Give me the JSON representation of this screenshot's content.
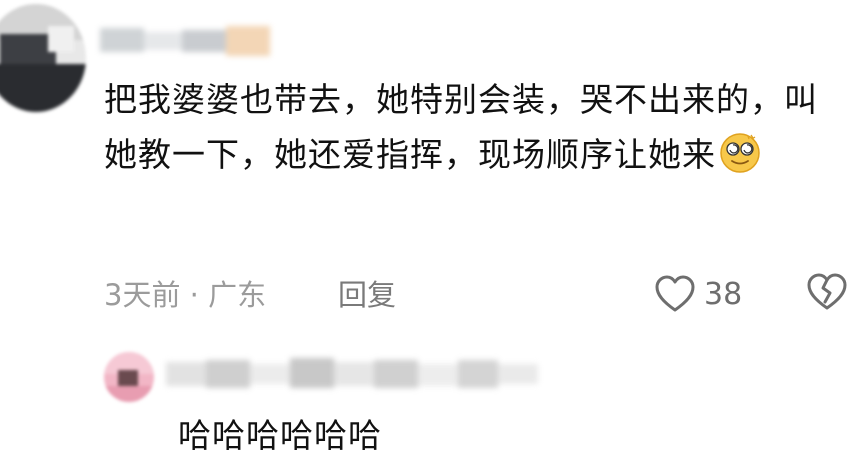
{
  "comment": {
    "text": "把我婆婆也带去，她特别会装，哭不出来的，叫她教一下，她还爱指挥，现场顺序让她来",
    "emoji_icon": "dizzy-face-emoji-icon",
    "time_location": "3天前 · 广东",
    "reply_label": "回复",
    "like_count": "38",
    "like_icon": "heart-outline-icon",
    "dislike_icon": "broken-heart-icon"
  },
  "reply": {
    "text": "哈哈哈哈哈哈"
  },
  "colors": {
    "text_primary": "#111111",
    "text_meta": "#9b9b9b",
    "icon_gray": "#6e6e6e"
  }
}
